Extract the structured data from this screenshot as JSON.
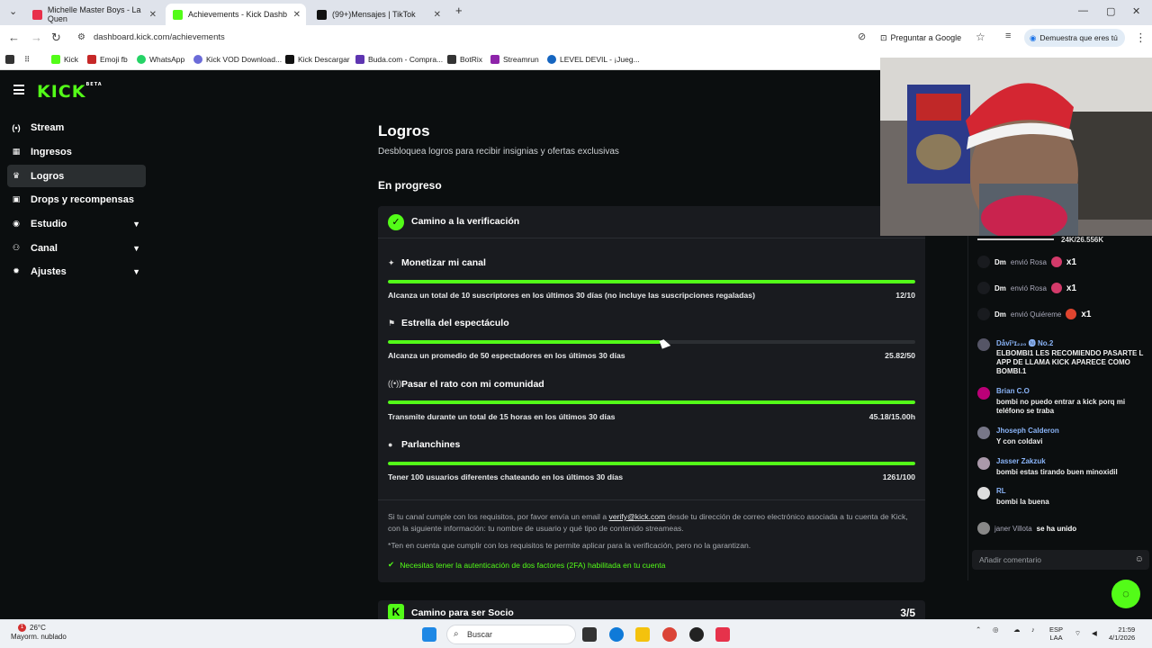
{
  "browser": {
    "tabs": [
      {
        "label": "Michelle Master Boys - La Quen",
        "color": "#e8304a"
      },
      {
        "label": "Achievements - Kick Dashb",
        "color": "#53fc18"
      },
      {
        "label": "(99+)Mensajes | TikTok",
        "color": "#111111"
      }
    ],
    "url": "dashboard.kick.com/achievements",
    "ask_google": "Preguntar a Google",
    "demo_label": "Demuestra que eres tú",
    "bookmarks": [
      {
        "label": "Kick",
        "color": "#53fc18"
      },
      {
        "label": "Emoji fb",
        "color": "#c62828"
      },
      {
        "label": "WhatsApp",
        "color": "#25d366"
      },
      {
        "label": "Kick VOD Download...",
        "color": "#6b6bd8"
      },
      {
        "label": "Kick Descargar",
        "color": "#111111"
      },
      {
        "label": "Buda.com - Compra...",
        "color": "#5e35b1"
      },
      {
        "label": "BotRix",
        "color": "#333333"
      },
      {
        "label": "Streamrun",
        "color": "#8e24aa"
      },
      {
        "label": "LEVEL DEVIL - ¡Jueg...",
        "color": "#1565c0"
      }
    ]
  },
  "sidebar": {
    "logo": "KICK",
    "logo_sup": "BETA",
    "items": [
      {
        "label": "Stream",
        "icon": "(•)"
      },
      {
        "label": "Ingresos",
        "icon": "▦"
      },
      {
        "label": "Logros",
        "icon": "♛"
      },
      {
        "label": "Drops y recompensas",
        "icon": "▣"
      },
      {
        "label": "Estudio",
        "icon": "◉"
      },
      {
        "label": "Canal",
        "icon": "⚇"
      },
      {
        "label": "Ajustes",
        "icon": "✹"
      }
    ]
  },
  "main": {
    "title": "Logros",
    "subtitle": "Desbloquea logros para recibir insignias y ofertas exclusivas",
    "section": "En progreso",
    "card_title": "Camino a la verificación",
    "requirements": [
      {
        "title": "Monetizar mi canal",
        "icon": "✦",
        "desc": "Alcanza un total de 10 suscriptores en los últimos 30 días (no incluye las suscripciones regaladas)",
        "value": "12/10",
        "progress": 1.0
      },
      {
        "title": "Estrella del espectáculo",
        "icon": "⚑",
        "desc": "Alcanza un promedio de 50 espectadores en los últimos 30 días",
        "value": "25.82/50",
        "progress": 0.5164
      },
      {
        "title": "Pasar el rato con mi comunidad",
        "icon": "((•))",
        "desc": "Transmite durante un total de 15 horas en los últimos 30 días",
        "value": "45.18/15.00h",
        "progress": 1.0
      },
      {
        "title": "Parlanchines",
        "icon": "●",
        "desc": "Tener 100 usuarios diferentes chateando en los últimos 30 días",
        "value": "1261/100",
        "progress": 1.0
      }
    ],
    "info_pre": "Si tu canal cumple con los requisitos, por favor envía un email a ",
    "info_email": "verify@kick.com",
    "info_post": " desde tu dirección de correo electrónico asociada a tu cuenta de Kick, con la siguiente información: tu nombre de usuario y qué tipo de contenido streameas.",
    "info_note": "*Ten en cuenta que cumplir con los requisitos te permite aplicar para la verificación, pero no la garantizan.",
    "info_2fa": "Necesitas tener la autenticación de dos factores (2FA) habilitada en tu cuenta",
    "card2_title": "Camino para ser Socio",
    "card2_value": "3/5"
  },
  "chat": {
    "stat": "24K/26.556K",
    "gifts": [
      {
        "user": "Dm",
        "action": "envió Rosa",
        "mult": "x1"
      },
      {
        "user": "Dm",
        "action": "envió Rosa",
        "mult": "x1"
      },
      {
        "user": "Dm",
        "action": "envió Quiéreme",
        "mult": "x1"
      }
    ],
    "messages": [
      {
        "user": "Dåvī³ɪ₂₂₀ 🅝 No.2",
        "text": "ELBOMBI1 LES RECOMIENDO PASARTE L APP DE LLAMA KICK APARECE COMO BOMBI.1",
        "color": "#8ab4f8"
      },
      {
        "user": "Brian C.O",
        "text": "bombi no puedo entrar a kick porq mi teléfono se traba",
        "color": "#8ab4f8"
      },
      {
        "user": "Jhoseph Calderon",
        "text": "Y con coldavi",
        "color": "#8ab4f8"
      },
      {
        "user": "Jasser Zakzuk",
        "text": "bombi estas tirando buen minoxidil",
        "color": "#8ab4f8"
      },
      {
        "user": "RL",
        "text": "bombi la buena",
        "color": "#8ab4f8"
      }
    ],
    "join_user": "janer Villota",
    "join_text": "se ha unido",
    "input_placeholder": "Añadir comentario"
  },
  "taskbar": {
    "temp": "26°C",
    "weather": "Mayorm. nublado",
    "search": "Buscar",
    "lang1": "ESP",
    "lang2": "LAA",
    "time": "21:59",
    "date": "4/1/2026",
    "notif": "1"
  }
}
